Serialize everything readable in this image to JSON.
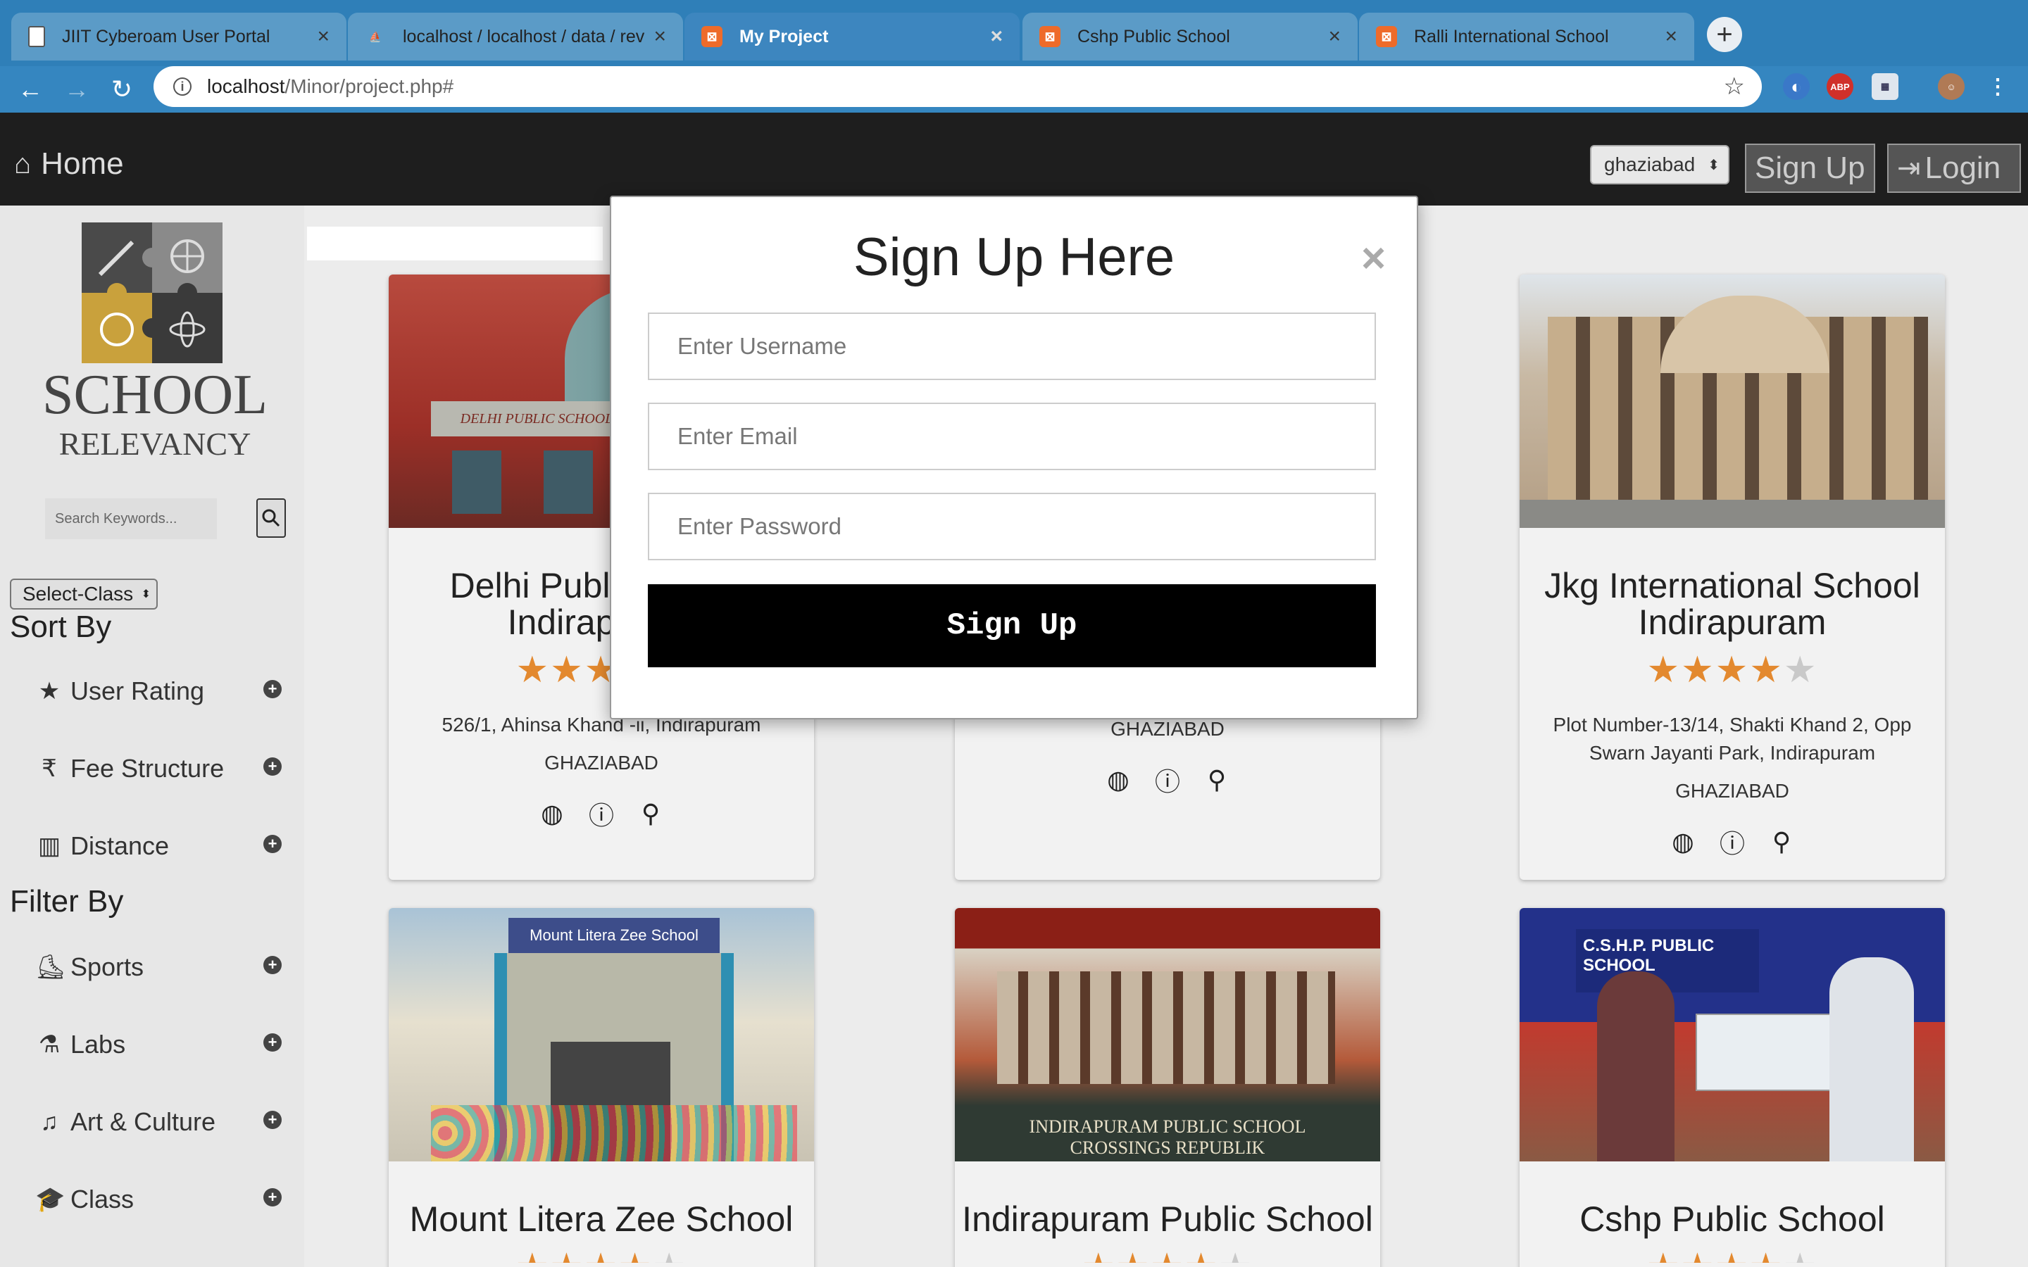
{
  "browser": {
    "tabs": [
      {
        "label": "JIIT Cyberoam User Portal",
        "active": false
      },
      {
        "label": "localhost / localhost / data / rev",
        "active": false
      },
      {
        "label": "My Project",
        "active": true
      },
      {
        "label": "Cshp Public School",
        "active": false
      },
      {
        "label": "Ralli International School",
        "active": false
      }
    ],
    "url_host": "localhost",
    "url_path": "/Minor/project.php#",
    "ext_abp": "ABP"
  },
  "nav": {
    "home": "Home",
    "city": "ghaziabad",
    "signup": "Sign Up",
    "login": "Login"
  },
  "sidebar": {
    "logo_line1": "SCHOOL",
    "logo_line2": "RELEVANCY",
    "search_placeholder": "Search Keywords...",
    "class_select": "Select-Class",
    "sort_heading": "Sort By",
    "sort_items": [
      "User Rating",
      "Fee Structure",
      "Distance"
    ],
    "filter_heading": "Filter By",
    "filter_items": [
      "Sports",
      "Labs",
      "Art & Culture",
      "Class"
    ]
  },
  "cards": [
    {
      "name": "Delhi Public School Indirapuram",
      "rating": 3,
      "address": "526/1, Ahinsa Khand -ii, Indirapuram",
      "city": "GHAZIABAD",
      "sign": "DELHI PUBLIC SCHOOL"
    },
    {
      "name": "",
      "rating": 0,
      "address": "",
      "city": "GHAZIABAD"
    },
    {
      "name": "Jkg International School Indirapuram",
      "rating": 4,
      "address": "Plot Number-13/14, Shakti Khand 2, Opp Swarn Jayanti Park, Indirapuram",
      "city": "GHAZIABAD"
    },
    {
      "name": "Mount Litera Zee School",
      "sign": "Mount Litera Zee School"
    },
    {
      "name": "Indirapuram Public School",
      "sign1": "INDIRAPURAM PUBLIC SCHOOL",
      "sign2": "CROSSINGS REPUBLIK"
    },
    {
      "name": "Cshp Public School",
      "sign": "C.S.H.P. PUBLIC SCHOOL"
    }
  ],
  "modal": {
    "title": "Sign Up Here",
    "close": "×",
    "username_placeholder": "Enter Username",
    "email_placeholder": "Enter Email",
    "password_placeholder": "Enter Password",
    "submit": "Sign Up"
  },
  "colors": {
    "star": "#e3892f",
    "nav_bg": "#1e1e1e",
    "chrome": "#2f7fb8"
  }
}
